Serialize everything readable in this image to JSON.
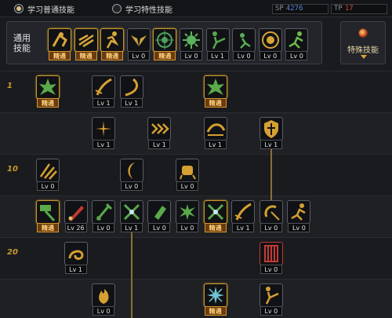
{
  "tabs": [
    {
      "label": "学习普通技能",
      "selected": true
    },
    {
      "label": "学习特性技能",
      "selected": false
    }
  ],
  "sp_counters": [
    {
      "label": "SP",
      "value": "4276",
      "color": "#5b87d8"
    },
    {
      "label": "TP",
      "value": "17",
      "color": "#d1463e"
    }
  ],
  "common_skills": {
    "label": "通用技能",
    "items": [
      {
        "tag": "精通",
        "icon": "leap-icon",
        "hue": "#d8a83a",
        "style": "gold"
      },
      {
        "tag": "精通",
        "icon": "dash-icon",
        "hue": "#d8a83a",
        "style": "gold"
      },
      {
        "tag": "精通",
        "icon": "runner-icon",
        "hue": "#d8a83a",
        "style": "gold"
      },
      {
        "tag": "Lv 0",
        "icon": "wings-icon",
        "hue": "#c9a53c",
        "style": "plain"
      },
      {
        "tag": "精通",
        "icon": "target-icon",
        "hue": "#4fa05a",
        "style": "gold"
      },
      {
        "tag": "Lv 0",
        "icon": "radial-icon",
        "hue": "#5db35c",
        "style": "plain"
      },
      {
        "tag": "Lv 1",
        "icon": "kick-icon",
        "hue": "#55a84e",
        "style": "plain"
      },
      {
        "tag": "Lv 0",
        "icon": "crouch-icon",
        "hue": "#58ac58",
        "style": "plain"
      },
      {
        "tag": "Lv 0",
        "icon": "emblem-icon",
        "hue": "#d6a437",
        "style": "plain"
      },
      {
        "tag": "Lv 0",
        "icon": "sprint-icon",
        "hue": "#6fbb4e",
        "style": "plain"
      }
    ]
  },
  "special_skill": {
    "label": "特殊技能"
  },
  "level_markers": [
    {
      "label": "1",
      "row": 0
    },
    {
      "label": "10",
      "row": 2
    },
    {
      "label": "20",
      "row": 4
    }
  ],
  "tree_rows": [
    {
      "skills": [
        {
          "col": 0,
          "tag": "精通",
          "icon": "burst-icon",
          "hue": "#5aa94a",
          "style": "gold"
        },
        {
          "col": 2,
          "tag": "Lv 1",
          "icon": "slash-icon",
          "hue": "#d5a032",
          "style": "plain"
        },
        {
          "col": 3,
          "tag": "Lv 1",
          "icon": "arc-icon",
          "hue": "#d5a032",
          "style": "plain"
        },
        {
          "col": 6,
          "tag": "精通",
          "icon": "burst-icon",
          "hue": "#5aa94a",
          "style": "gold"
        }
      ]
    },
    {
      "skills": [
        {
          "col": 2,
          "tag": "Lv 1",
          "icon": "spark-icon",
          "hue": "#d5a032",
          "style": "plain"
        },
        {
          "col": 4,
          "tag": "Lv 1",
          "icon": "chevrons-icon",
          "hue": "#d5a032",
          "style": "plain"
        },
        {
          "col": 6,
          "tag": "Lv 1",
          "icon": "sweep-icon",
          "hue": "#d5a032",
          "style": "plain"
        },
        {
          "col": 8,
          "tag": "Lv 1",
          "icon": "shield-icon",
          "hue": "#d5a032",
          "style": "plain"
        }
      ]
    },
    {
      "skills": [
        {
          "col": 0,
          "tag": "Lv 0",
          "icon": "claw-icon",
          "hue": "#d5a032",
          "style": "plain"
        },
        {
          "col": 3,
          "tag": "Lv 0",
          "icon": "moon-icon",
          "hue": "#d5a032",
          "style": "plain"
        },
        {
          "col": 5,
          "tag": "Lv 0",
          "icon": "fist-icon",
          "hue": "#d5a032",
          "style": "plain"
        }
      ]
    },
    {
      "skills": [
        {
          "col": 0,
          "tag": "精通",
          "icon": "hammer-icon",
          "hue": "#5aa94a",
          "style": "gold"
        },
        {
          "col": 1,
          "tag": "Lv 26",
          "icon": "blade-icon",
          "hue": "#c23a33",
          "style": "plain"
        },
        {
          "col": 2,
          "tag": "Lv 0",
          "icon": "sword-icon",
          "hue": "#5aa94a",
          "style": "plain"
        },
        {
          "col": 3,
          "tag": "Lv 1",
          "icon": "cross-swords-icon",
          "hue": "#5aa94a",
          "style": "plain"
        },
        {
          "col": 4,
          "tag": "Lv 0",
          "icon": "gauntlet-icon",
          "hue": "#5aa94a",
          "style": "plain"
        },
        {
          "col": 5,
          "tag": "Lv 0",
          "icon": "star-burst-icon",
          "hue": "#5aa94a",
          "style": "plain"
        },
        {
          "col": 6,
          "tag": "精通",
          "icon": "cross-swords-icon",
          "hue": "#5aa94a",
          "style": "gold"
        },
        {
          "col": 7,
          "tag": "Lv 1",
          "icon": "slash-icon",
          "hue": "#d5a032",
          "style": "plain"
        },
        {
          "col": 8,
          "tag": "Lv 0",
          "icon": "spin-icon",
          "hue": "#d5a032",
          "style": "plain"
        },
        {
          "col": 9,
          "tag": "Lv 0",
          "icon": "sprint-icon",
          "hue": "#d5a032",
          "style": "plain"
        }
      ]
    },
    {
      "skills": [
        {
          "col": 1,
          "tag": "Lv 1",
          "icon": "swirl-icon",
          "hue": "#d5a032",
          "style": "plain"
        },
        {
          "col": 8,
          "tag": "Lv 0",
          "icon": "pillar-icon",
          "hue": "#c23a33",
          "style": "red"
        }
      ]
    },
    {
      "skills": [
        {
          "col": 2,
          "tag": "Lv 0",
          "icon": "flame-icon",
          "hue": "#d5a032",
          "style": "plain"
        },
        {
          "col": 6,
          "tag": "精通",
          "icon": "ice-burst-icon",
          "hue": "#6fc6d6",
          "style": "gold"
        },
        {
          "col": 8,
          "tag": "Lv 0",
          "icon": "kick-icon",
          "hue": "#d5a032",
          "style": "plain"
        }
      ]
    }
  ]
}
